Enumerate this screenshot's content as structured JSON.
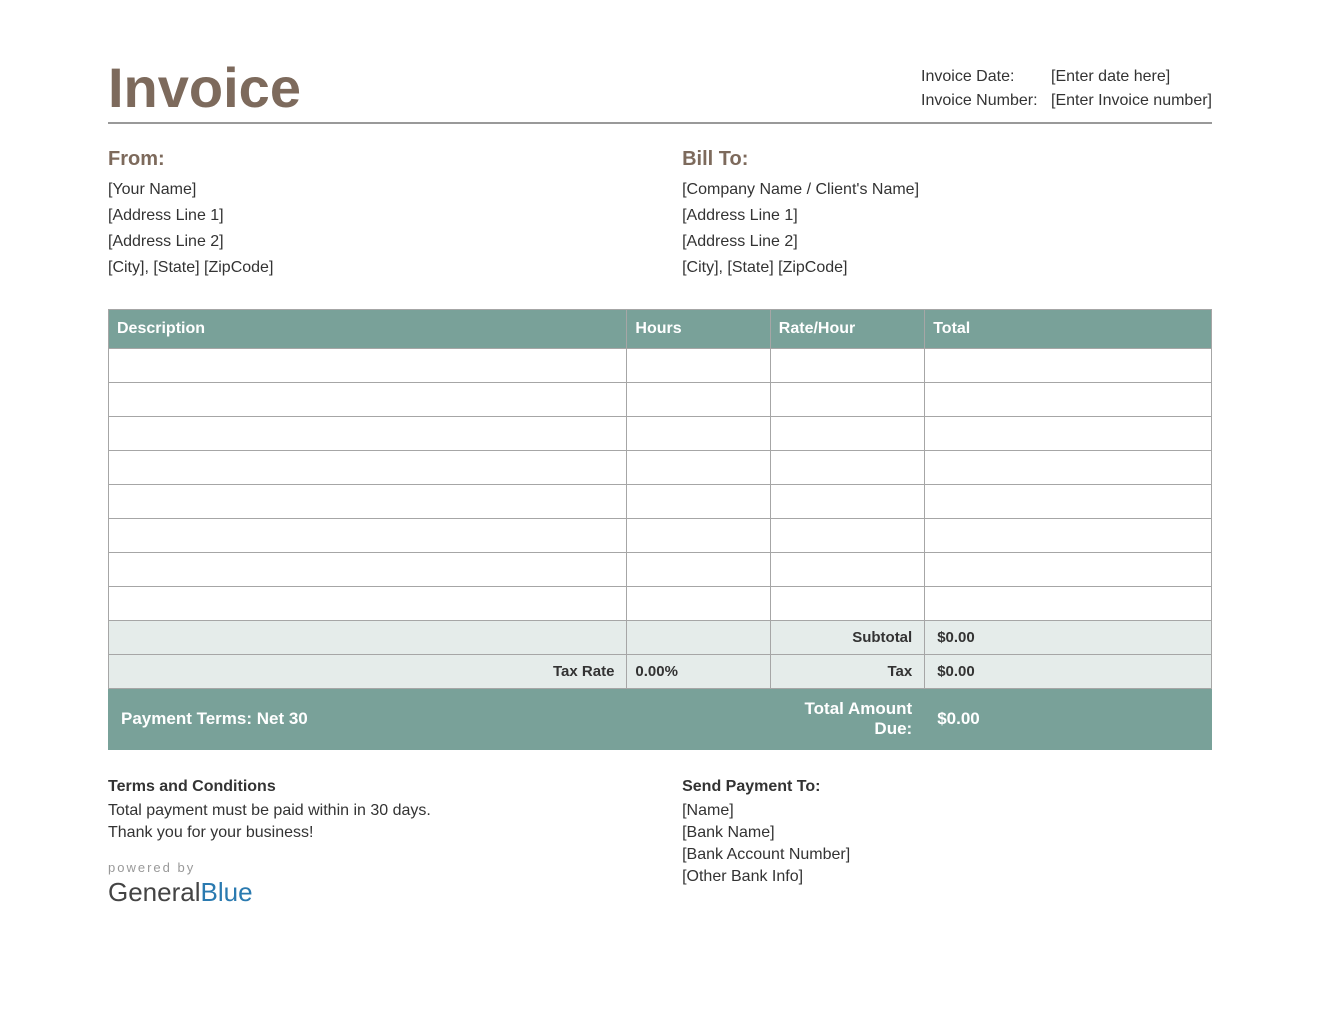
{
  "title": "Invoice",
  "meta": {
    "date_label": "Invoice Date:",
    "date_value": "[Enter date here]",
    "number_label": "Invoice Number:",
    "number_value": "[Enter Invoice number]"
  },
  "from": {
    "heading": "From:",
    "lines": [
      "[Your Name]",
      "[Address Line 1]",
      "[Address Line 2]",
      "[City], [State] [ZipCode]"
    ]
  },
  "billto": {
    "heading": "Bill To:",
    "lines": [
      "[Company Name / Client's Name]",
      "[Address Line 1]",
      "[Address Line 2]",
      "[City], [State] [ZipCode]"
    ]
  },
  "table": {
    "headers": [
      "Description",
      "Hours",
      "Rate/Hour",
      "Total"
    ],
    "rows": [
      [
        "",
        "",
        "",
        ""
      ],
      [
        "",
        "",
        "",
        ""
      ],
      [
        "",
        "",
        "",
        ""
      ],
      [
        "",
        "",
        "",
        ""
      ],
      [
        "",
        "",
        "",
        ""
      ],
      [
        "",
        "",
        "",
        ""
      ],
      [
        "",
        "",
        "",
        ""
      ],
      [
        "",
        "",
        "",
        ""
      ]
    ],
    "subtotal_label": "Subtotal",
    "subtotal_value": "$0.00",
    "taxrate_label": "Tax Rate",
    "taxrate_value": "0.00%",
    "tax_label": "Tax",
    "tax_value": "$0.00",
    "payment_terms": "Payment Terms: Net 30",
    "total_due_label": "Total Amount Due:",
    "total_due_value": "$0.00"
  },
  "terms": {
    "heading": "Terms and Conditions",
    "lines": [
      "Total payment must be paid within in 30 days.",
      "Thank you for your business!"
    ]
  },
  "payto": {
    "heading": "Send Payment To:",
    "lines": [
      "[Name]",
      "[Bank Name]",
      "[Bank Account Number]",
      "[Other Bank Info]"
    ]
  },
  "powered": {
    "pb": "powered by",
    "brand_g": "General",
    "brand_b": "Blue"
  }
}
